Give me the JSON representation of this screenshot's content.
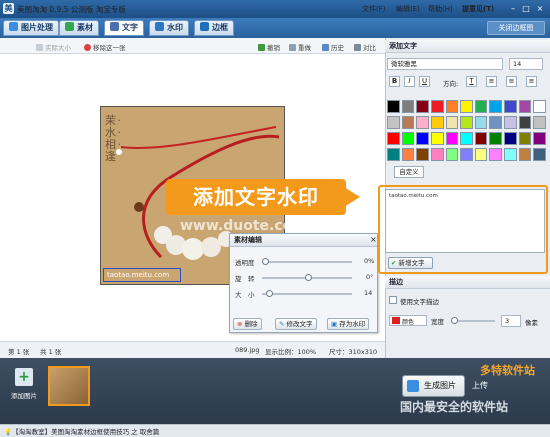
{
  "window": {
    "title": "美图淘淘 0.9.5 公测版 淘宝专版",
    "minimize_icon": "minimize-icon",
    "maximize_icon": "maximize-icon",
    "close_icon": "close-icon"
  },
  "menu": [
    "文件(F)",
    "编辑(E)",
    "帮助(H)",
    "提意见(T)"
  ],
  "tabs": [
    {
      "label": "图片处理",
      "icon": "image-edit-icon",
      "color": "#3a8de0"
    },
    {
      "label": "素材",
      "icon": "material-icon",
      "color": "#2fa84f"
    },
    {
      "label": "文字",
      "icon": "text-icon",
      "color": "#4a6fb0"
    },
    {
      "label": "水印",
      "icon": "watermark-icon",
      "color": "#2a79c7"
    },
    {
      "label": "边框",
      "icon": "frame-icon",
      "color": "#1f6fbf"
    }
  ],
  "active_tab": "文字",
  "close_panel": "关闭边框图",
  "toolbar": {
    "actual_size": "实际大小",
    "remove_one": "移除这一张",
    "undo": "撤销",
    "redo": "重做",
    "history": "历史",
    "compare": "对比"
  },
  "photo": {
    "stamp": "茉 · 水 · 相 · 逢",
    "caption": "taotao.meitu.com"
  },
  "canvas_watermark": "www.duote.com",
  "callout": "添加文字水印",
  "material_panel": {
    "title": "素材编辑",
    "sliders": [
      {
        "label": "透明度",
        "value": "0%",
        "level": 0
      },
      {
        "label": "旋　转",
        "value": "0°",
        "level": 0.5
      },
      {
        "label": "大　小",
        "value": "14",
        "level": 0.05
      }
    ],
    "buttons": [
      "删除",
      "修改文字",
      "存为水印"
    ]
  },
  "status": {
    "page": "第 1 张",
    "total": "共 1 张",
    "filename": "089.jpg",
    "scale": "显示比例：100%",
    "size": "尺寸：310x310"
  },
  "right_panel": {
    "header": "添加文字",
    "font": "微软雅黑",
    "font_size": "14",
    "format": [
      "B",
      "I",
      "U"
    ],
    "align_label": "方向:",
    "align": [
      "T",
      "≡",
      "≡",
      "≡"
    ],
    "custom_color": "自定义",
    "text_value": "taotao.meitu.com",
    "new_text_button": "新增文字",
    "stroke_header": "描边",
    "stroke_checkbox": "使用文字描边",
    "color_label": "颜色",
    "width_label": "宽度",
    "width_value": "3",
    "width_unit": "像素",
    "stroke_color": "#e02020",
    "palette": [
      "#000000",
      "#7f7f7f",
      "#880015",
      "#ed1c24",
      "#ff7f27",
      "#fff200",
      "#22b14c",
      "#00a2e8",
      "#3f48cc",
      "#a349a4",
      "#ffffff",
      "#c3c3c3",
      "#b97a57",
      "#ffaec9",
      "#ffc90e",
      "#efe4b0",
      "#b5e61d",
      "#99d9ea",
      "#7092be",
      "#c8bfe7",
      "#404040",
      "#c0c0c0",
      "#ff0000",
      "#00ff00",
      "#0000ff",
      "#ffff00",
      "#ff00ff",
      "#00ffff",
      "#800000",
      "#008000",
      "#000080",
      "#808000",
      "#800080",
      "#008080",
      "#ff8040",
      "#804000",
      "#ff80c0",
      "#80ff80",
      "#8080ff",
      "#ffff80",
      "#ff80ff",
      "#80ffff",
      "#c08040",
      "#406080"
    ]
  },
  "bottom": {
    "add_image": "添加图片",
    "generate": "生成图片",
    "upload": "上传"
  },
  "tip": "【淘淘教室】美图淘淘素材边框使用技巧 之 取舍篇",
  "site_watermark": "国内最安全的软件站",
  "site_logo": "多特软件站"
}
